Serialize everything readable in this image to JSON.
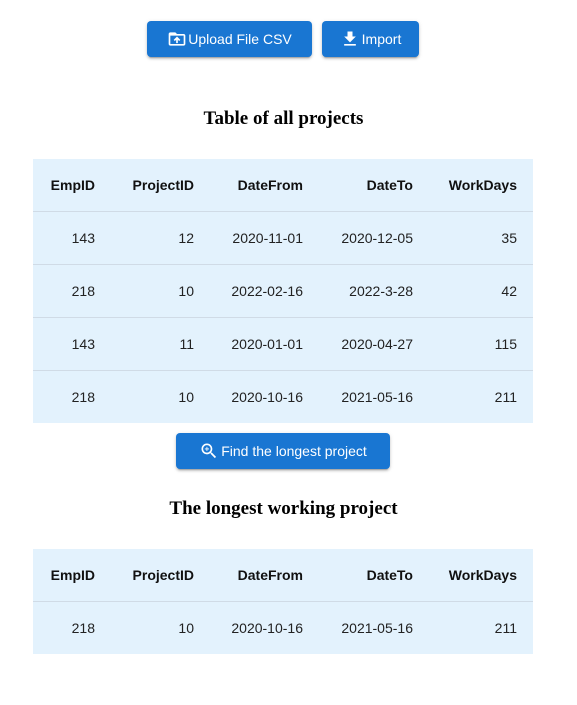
{
  "toolbar": {
    "upload_label": "Upload File CSV",
    "import_label": "Import"
  },
  "all_projects": {
    "title": "Table of all projects",
    "columns": [
      "EmpID",
      "ProjectID",
      "DateFrom",
      "DateTo",
      "WorkDays"
    ],
    "rows": [
      [
        "143",
        "12",
        "2020-11-01",
        "2020-12-05",
        "35"
      ],
      [
        "218",
        "10",
        "2022-02-16",
        "2022-3-28",
        "42"
      ],
      [
        "143",
        "11",
        "2020-01-01",
        "2020-04-27",
        "115"
      ],
      [
        "218",
        "10",
        "2020-10-16",
        "2021-05-16",
        "211"
      ]
    ]
  },
  "find_button": {
    "label": "Find the longest project"
  },
  "longest_project": {
    "title": "The longest working project",
    "columns": [
      "EmpID",
      "ProjectID",
      "DateFrom",
      "DateTo",
      "WorkDays"
    ],
    "rows": [
      [
        "218",
        "10",
        "2020-10-16",
        "2021-05-16",
        "211"
      ]
    ]
  },
  "colors": {
    "primary": "#1976d2",
    "table_bg": "#e3f2fd"
  },
  "icons": {
    "upload": "upload-folder-icon",
    "import": "download-icon",
    "find": "zoom-in-icon"
  }
}
